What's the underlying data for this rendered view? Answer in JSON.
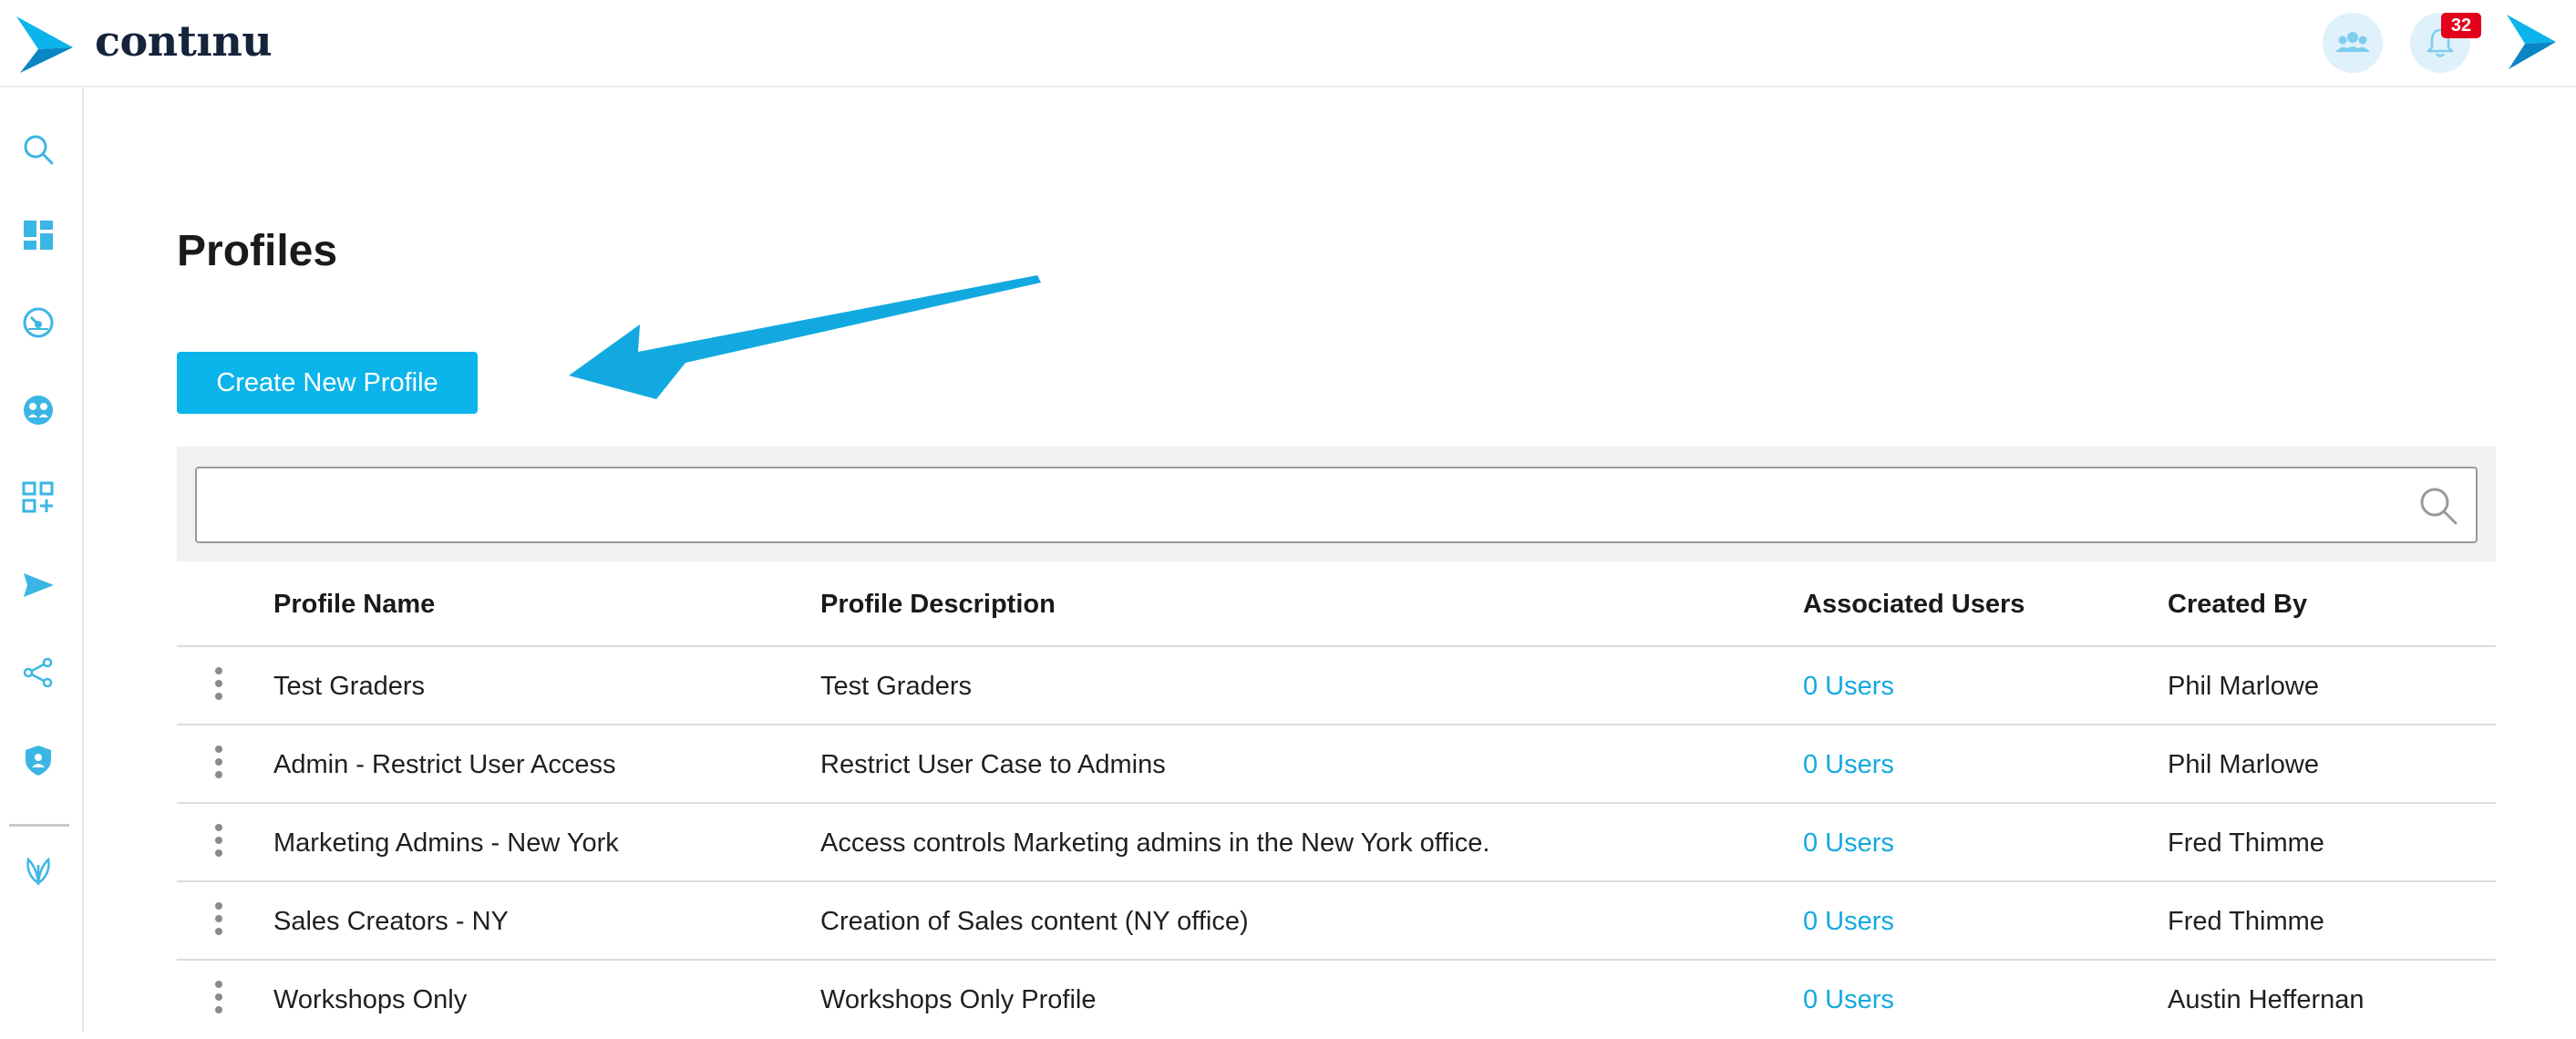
{
  "app": {
    "brand_name": "contınu",
    "brand_color": "#0bb4ea",
    "notification_count": "32"
  },
  "header": {
    "icons": [
      "users-icon",
      "bell-icon",
      "continu-arrow-icon"
    ]
  },
  "sidebar": {
    "items": [
      {
        "icon": "search-icon"
      },
      {
        "icon": "dashboard-icon"
      },
      {
        "icon": "compass-icon"
      },
      {
        "icon": "community-icon"
      },
      {
        "icon": "add-widgets-icon"
      },
      {
        "icon": "send-icon"
      },
      {
        "icon": "share-icon"
      },
      {
        "icon": "admin-shield-icon"
      },
      {
        "icon": "leaf-logo-icon"
      }
    ]
  },
  "main": {
    "title": "Profiles",
    "create_button_label": "Create New Profile",
    "search": {
      "value": "",
      "placeholder": ""
    },
    "table": {
      "headers": {
        "name": "Profile Name",
        "description": "Profile Description",
        "users": "Associated Users",
        "created_by": "Created By"
      },
      "rows": [
        {
          "name": "Test Graders",
          "description": "Test Graders",
          "users": "0 Users",
          "created_by": "Phil Marlowe"
        },
        {
          "name": "Admin - Restrict User Access",
          "description": "Restrict User Case to Admins",
          "users": "0 Users",
          "created_by": "Phil Marlowe"
        },
        {
          "name": "Marketing Admins - New York",
          "description": "Access controls Marketing admins in the New York office.",
          "users": "0 Users",
          "created_by": "Fred Thimme"
        },
        {
          "name": "Sales Creators - NY",
          "description": "Creation of Sales content (NY office)",
          "users": "0 Users",
          "created_by": "Fred Thimme"
        },
        {
          "name": "Workshops Only",
          "description": "Workshops Only Profile",
          "users": "0 Users",
          "created_by": "Austin Heffernan"
        }
      ]
    }
  }
}
